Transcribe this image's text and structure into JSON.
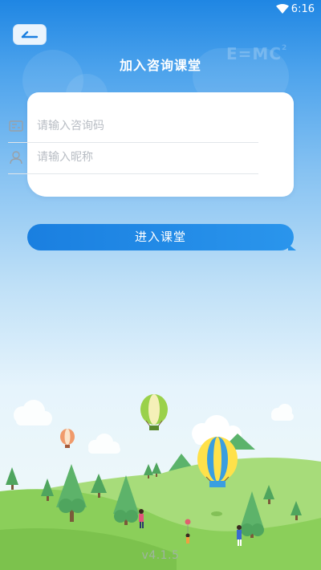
{
  "status_bar": {
    "time": "6:16",
    "wifi_icon": "wifi-icon"
  },
  "header": {
    "title": "加入咨询课堂",
    "back_icon": "back-arrow-icon"
  },
  "decoration": {
    "formula_base": "E=MC",
    "formula_exp": "2"
  },
  "form": {
    "code_field": {
      "placeholder": "请输入咨询码",
      "value": "",
      "icon": "id-card-icon"
    },
    "nickname_field": {
      "placeholder": "请输入昵称",
      "value": "",
      "icon": "user-icon"
    }
  },
  "actions": {
    "enter_label": "进入课堂"
  },
  "footer": {
    "version": "v4.1.5"
  },
  "colors": {
    "primary": "#1a7fe0",
    "background_top": "#1f86e3",
    "hill_green": "#8bcf5a"
  }
}
